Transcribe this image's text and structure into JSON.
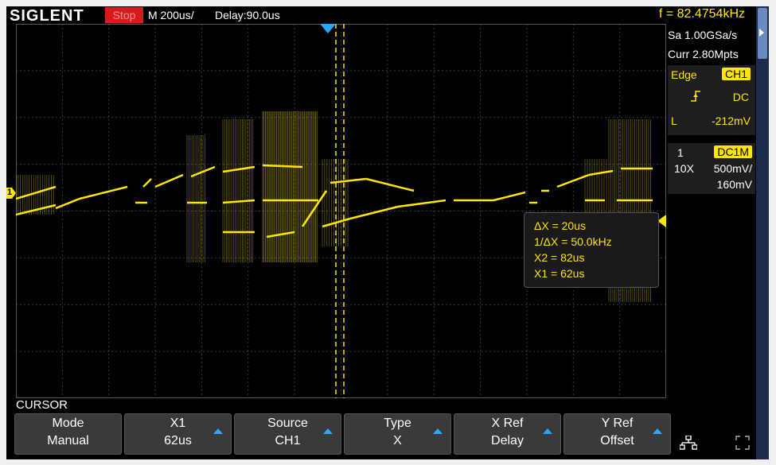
{
  "header": {
    "logo": "SIGLENT",
    "status": "Stop",
    "timebase": "M 200us/",
    "delay": "Delay:90.0us",
    "frequency": "f = 82.4754kHz"
  },
  "acquisition": {
    "sample_rate": "Sa 1.00GSa/s",
    "memory": "Curr 2.80Mpts"
  },
  "trigger": {
    "type": "Edge",
    "source": "CH1",
    "coupling": "DC",
    "level_prefix": "L",
    "level": "-212mV"
  },
  "channel": {
    "number": "1",
    "coupling": "DC1M",
    "probe": "10X",
    "scale": "500mV/",
    "offset": "160mV",
    "marker": "1"
  },
  "cursor_info": {
    "dx": "ΔX = 20us",
    "inv_dx": "1/ΔX = 50.0kHz",
    "x2": "X2 = 82us",
    "x1": "X1 = 62us"
  },
  "menu": {
    "title": "CURSOR",
    "buttons": [
      {
        "label": "Mode",
        "value": "Manual"
      },
      {
        "label": "X1",
        "value": "62us"
      },
      {
        "label": "Source",
        "value": "CH1"
      },
      {
        "label": "Type",
        "value": "X"
      },
      {
        "label": "X Ref",
        "value": "Delay"
      },
      {
        "label": "Y Ref",
        "value": "Offset"
      }
    ],
    "network_icon": "network-icon",
    "fullscreen_icon": "fullscreen-icon"
  },
  "colors": {
    "trace": "#ffe600",
    "accent": "#2aa8ff",
    "stop": "#d41c1c"
  }
}
